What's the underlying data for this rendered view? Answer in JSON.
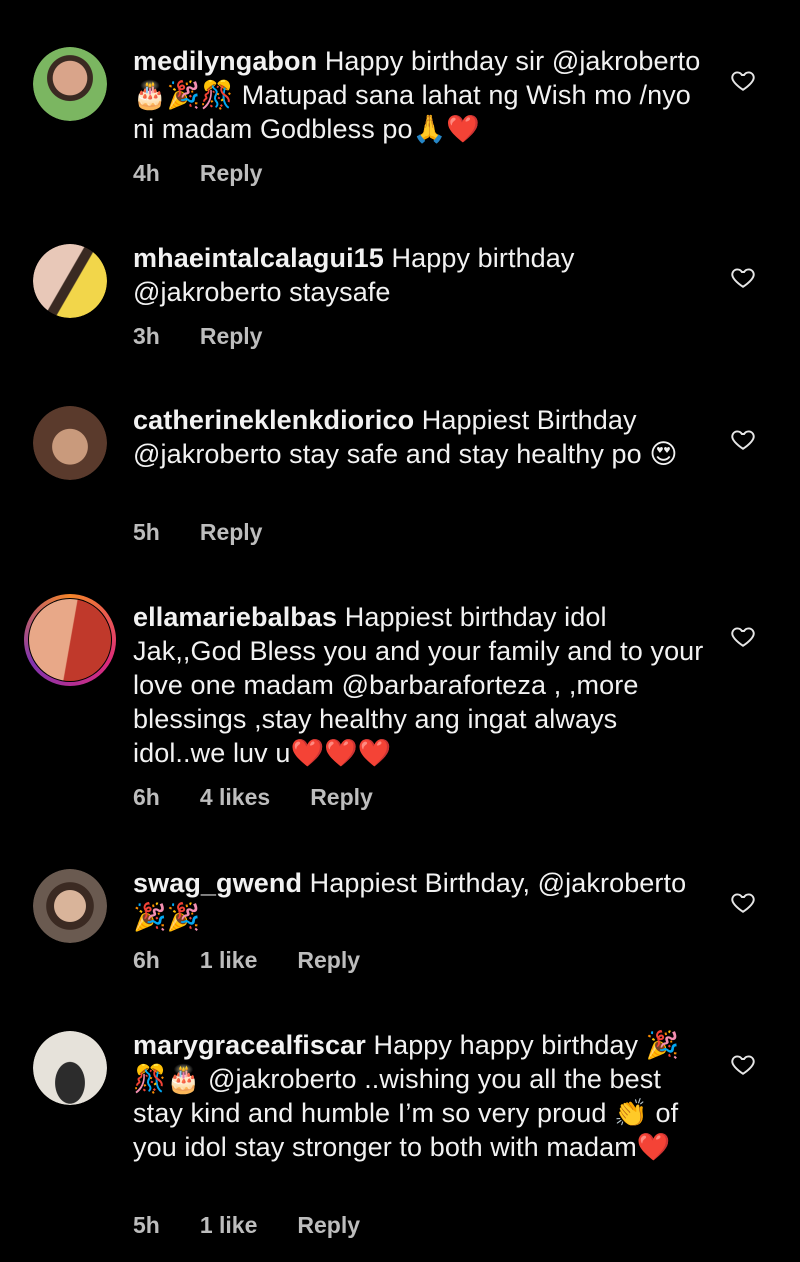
{
  "comments": [
    {
      "username": "medilyngabon",
      "text": " Happy birthday sir @jakroberto🎂🎉🎊 Matupad sana lahat ng Wish mo /nyo ni madam Godbless po🙏❤️",
      "time": "4h",
      "likes": "",
      "reply": "Reply",
      "avatar_colors": [
        "#7bb661",
        "#d9a48a"
      ]
    },
    {
      "username": "mhaeintalcalagui15",
      "text": " Happy birthday @jakroberto staysafe",
      "time": "3h",
      "likes": "",
      "reply": "Reply",
      "avatar_colors": [
        "#e8c8b8",
        "#f2d64a"
      ]
    },
    {
      "username": "catherineklenkdiorico",
      "text": " Happiest Birthday @jakroberto  stay safe and stay healthy po 😍",
      "time": "5h",
      "likes": "",
      "reply": "Reply",
      "avatar_colors": [
        "#5a3a2c",
        "#c99a7c"
      ]
    },
    {
      "username": "ellamariebalbas",
      "text": " Happiest birthday idol Jak,,God Bless you and your family and to your love one madam @barbaraforteza , ,more blessings ,stay healthy ang ingat always idol..we luv u❤️❤️❤️",
      "time": "6h",
      "likes": "4 likes",
      "reply": "Reply",
      "avatar_colors": [
        "#c0392b",
        "#e8a888"
      ]
    },
    {
      "username": "swag_gwend",
      "text": " Happiest Birthday, @jakroberto 🎉🎉",
      "time": "6h",
      "likes": "1 like",
      "reply": "Reply",
      "avatar_colors": [
        "#3b2a22",
        "#d9b49a"
      ]
    },
    {
      "username": "marygracealfiscar",
      "text": " Happy happy birthday 🎉🎊🎂 @jakroberto ..wishing you all the best stay kind and humble I’m so very proud 👏 of you idol stay stronger to both with madam❤️",
      "time": "5h",
      "likes": "1 like",
      "reply": "Reply",
      "avatar_colors": [
        "#e6e2da",
        "#2c2c2c"
      ]
    }
  ]
}
